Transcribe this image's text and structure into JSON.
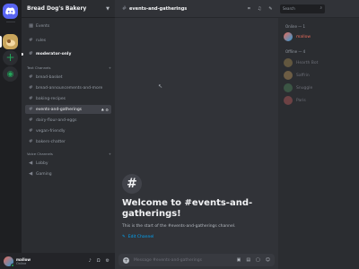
{
  "server": {
    "name": "Bread Dog's Bakery"
  },
  "channels": {
    "top": [
      {
        "label": "Events",
        "icon": "calendar-icon"
      },
      {
        "label": "rules",
        "icon": "hash"
      },
      {
        "label": "moderator-only",
        "icon": "hash"
      }
    ],
    "text_category": "Text Channels",
    "text": [
      {
        "label": "bread-basket"
      },
      {
        "label": "bread-announcements-and-more"
      },
      {
        "label": "baking-recipes"
      },
      {
        "label": "events-and-gatherings"
      },
      {
        "label": "dairy-flour-and-eggs"
      },
      {
        "label": "vegan-friendly"
      },
      {
        "label": "bakers-chatter"
      }
    ],
    "voice_category": "Voice Channels",
    "voice": [
      {
        "label": "Lobby"
      },
      {
        "label": "Gaming"
      }
    ]
  },
  "user": {
    "name": "mallow",
    "status": "Online"
  },
  "topbar": {
    "channel": "events-and-gatherings",
    "search_placeholder": "Search"
  },
  "welcome": {
    "title": "Welcome to #events-and-gatherings!",
    "subtitle": "This is the start of the #events-and-gatherings channel.",
    "edit_label": "Edit Channel"
  },
  "composer": {
    "placeholder": "Message #events-and-gatherings"
  },
  "members": {
    "online_label": "Online — 1",
    "offline_label": "Offline — 4",
    "online": [
      {
        "name": "mallow",
        "color": "#e86b5a"
      }
    ],
    "offline": [
      {
        "name": "Hearth Bot",
        "color": "#c9a55c"
      },
      {
        "name": "Saffrin",
        "color": "#e8b86b"
      },
      {
        "name": "Snuggle",
        "color": "#5aa06b"
      },
      {
        "name": "Paris",
        "color": "#e86b6b"
      }
    ]
  },
  "colors": {
    "accent": "#5865f2",
    "online": "#23a55a",
    "link": "#00a8fc"
  }
}
